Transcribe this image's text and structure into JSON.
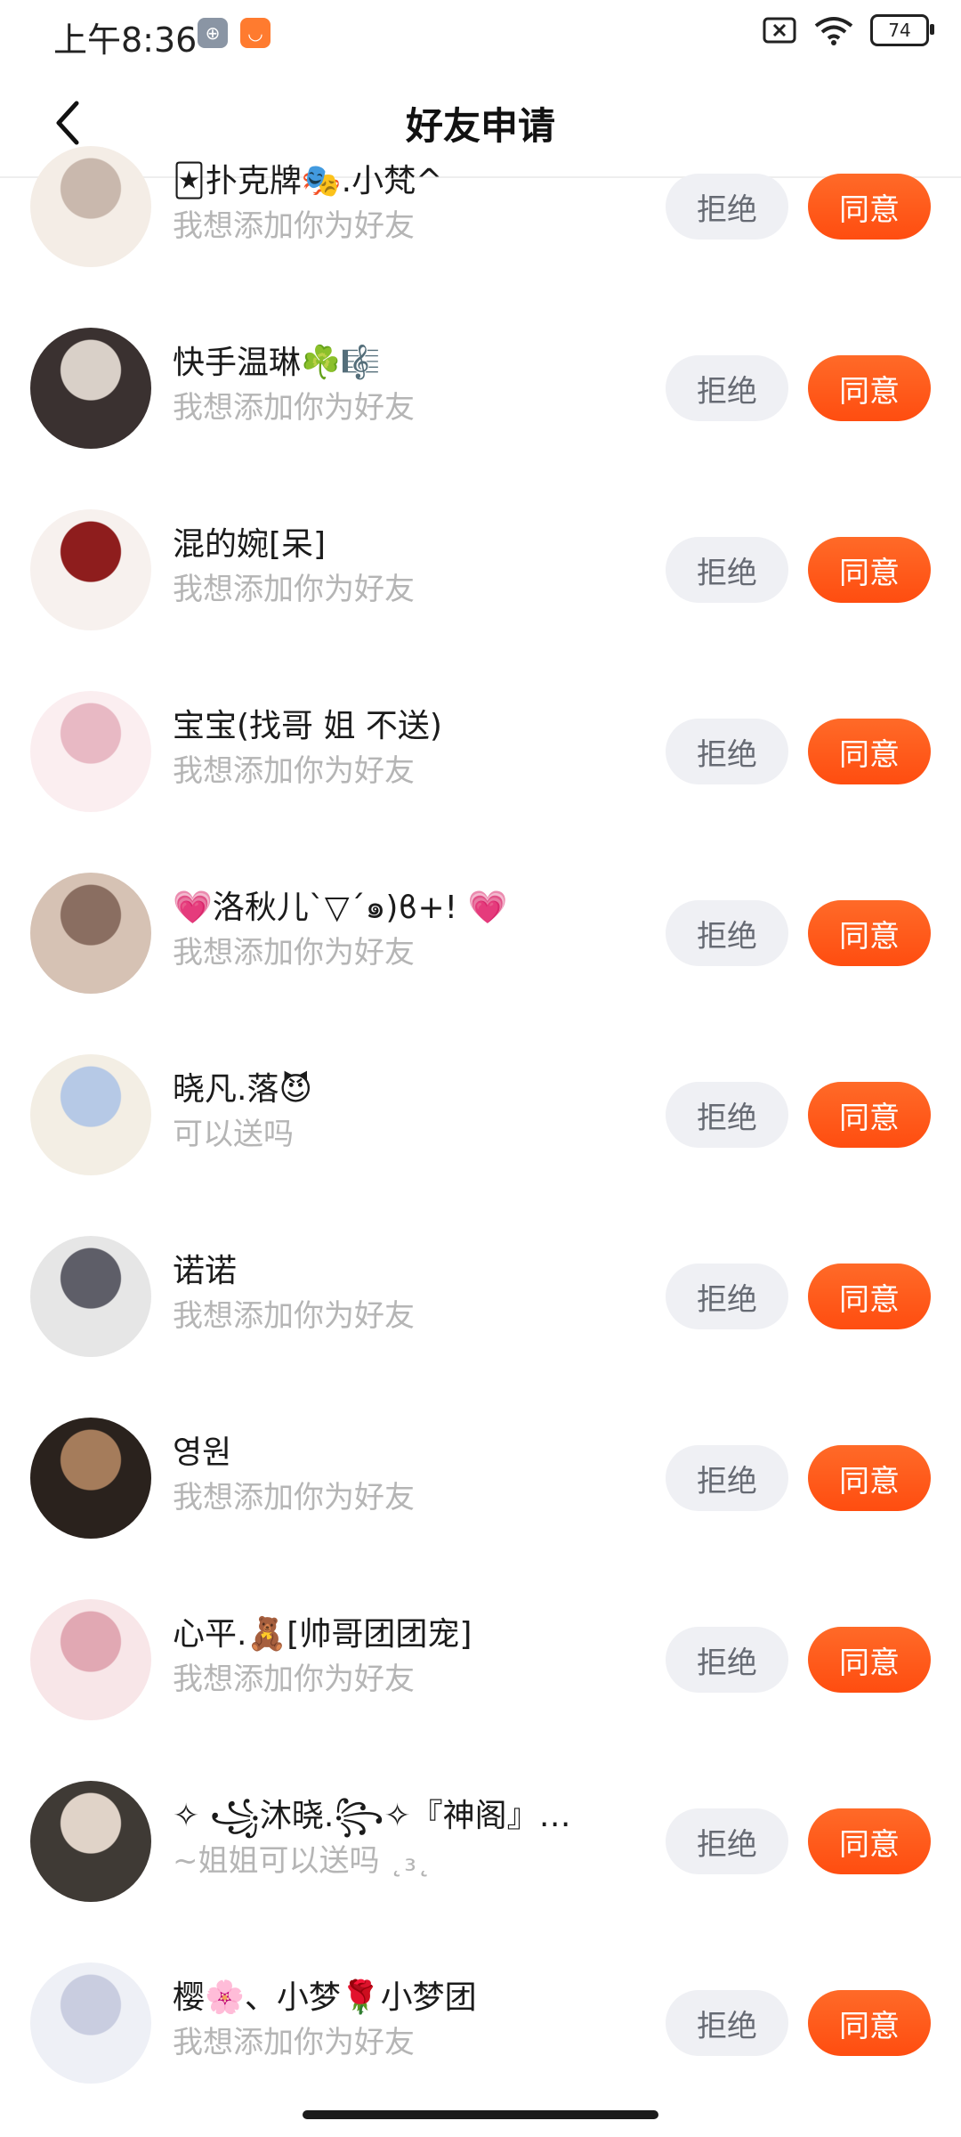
{
  "status_bar": {
    "time": "上午8:36",
    "battery": "74",
    "icons": [
      "steering-wheel-icon",
      "shopping-bag-icon",
      "screen-off-icon",
      "wifi-icon",
      "battery-icon"
    ]
  },
  "header": {
    "title": "好友申请",
    "back_icon": "chevron-left-icon"
  },
  "buttons": {
    "reject": "拒绝",
    "agree": "同意"
  },
  "requests": [
    {
      "name": "🃏扑克牌🎭.小梵^",
      "message": "我想添加你为好友"
    },
    {
      "name": "快手温琳☘️🎼",
      "message": "我想添加你为好友"
    },
    {
      "name": "混的婉[呆]",
      "message": "我想添加你为好友"
    },
    {
      "name": "宝宝(找哥 姐 不送)",
      "message": "我想添加你为好友"
    },
    {
      "name": "💗洛秋儿`▽´๑)ϐ+!  💗",
      "message": "我想添加你为好友"
    },
    {
      "name": "晓凡.落😈",
      "message": "可以送吗"
    },
    {
      "name": "诺诺",
      "message": "我想添加你为好友"
    },
    {
      "name": "영원",
      "message": "我想添加你为好友"
    },
    {
      "name": "心平.🧸[帅哥团团宠]",
      "message": "我想添加你为好友"
    },
    {
      "name": "✧ ꧁沐晓.꧂✧『神阁』…",
      "message": "~姐姐可以送吗 ˛₃˛"
    },
    {
      "name": "樱🌸、小梦🌹小梦团",
      "message": "我想添加你为好友"
    }
  ],
  "colors": {
    "accent": "#ff5a1a",
    "reject_bg": "#eff0f4",
    "secondary_text": "#b5b5b5"
  }
}
